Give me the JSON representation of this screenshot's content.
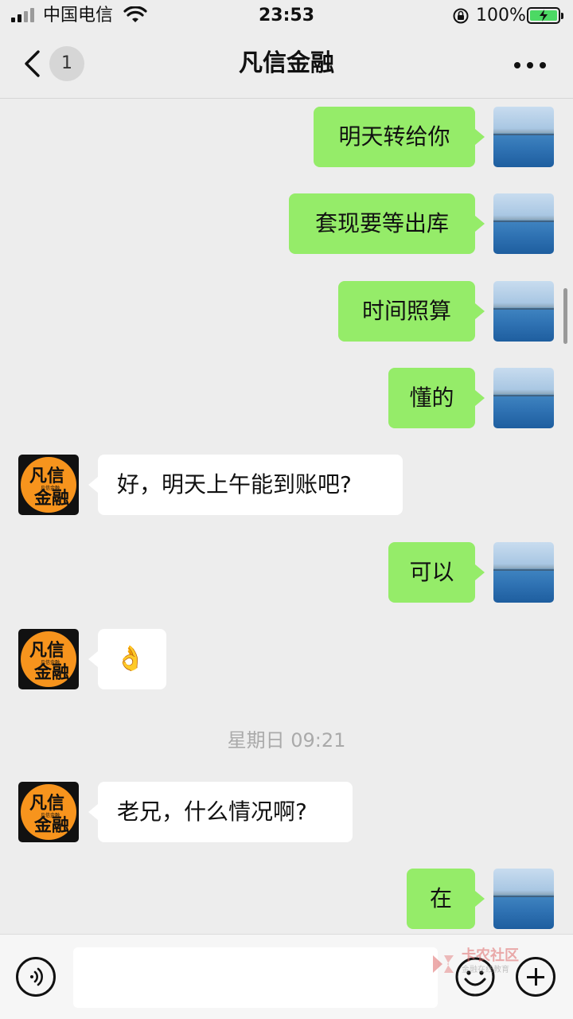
{
  "status_bar": {
    "carrier": "中国电信",
    "time": "23:53",
    "battery": "100%"
  },
  "nav": {
    "unread_count": "1",
    "title": "凡信金融"
  },
  "messages": [
    {
      "from": "me",
      "text": "明天转给你"
    },
    {
      "from": "me",
      "text": "套现要等出库"
    },
    {
      "from": "me",
      "text": "时间照算"
    },
    {
      "from": "me",
      "text": "懂的"
    },
    {
      "from": "them",
      "text": "好，明天上午能到账吧?"
    },
    {
      "from": "me",
      "text": "可以"
    },
    {
      "from": "them",
      "text": "👌"
    },
    {
      "from": "them",
      "text": "老兄，什么情况啊?"
    },
    {
      "from": "me",
      "text": "在"
    }
  ],
  "timestamp": "星期日 09:21",
  "contact_avatar": {
    "line1": "凡信",
    "line2": "金融",
    "small": "凡信金融"
  },
  "colors": {
    "outgoing_bubble": "#95ec69",
    "incoming_bubble": "#ffffff",
    "background": "#ededed",
    "avatar_orange": "#f7941d"
  },
  "watermark": {
    "title": "卡农社区",
    "subtitle": "金融在线教育"
  },
  "icons": [
    "back-icon",
    "more-icon",
    "voice-icon",
    "emoji-icon",
    "plus-icon",
    "wifi-icon",
    "lock-rotation-icon",
    "battery-icon"
  ]
}
